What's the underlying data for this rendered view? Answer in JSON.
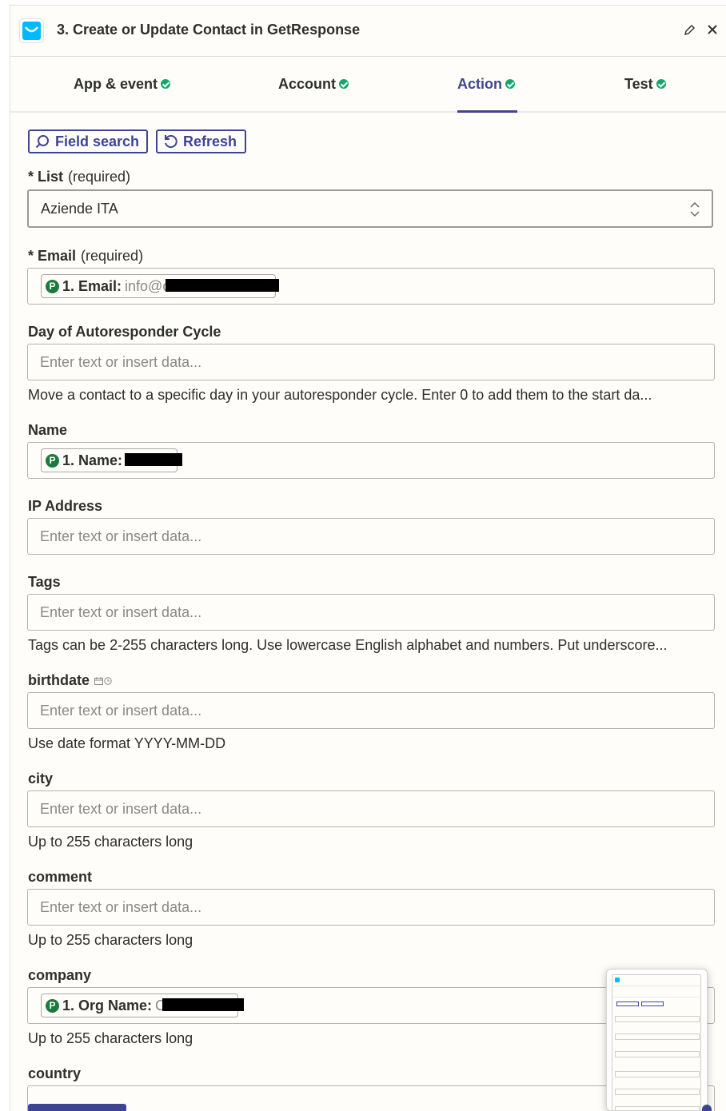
{
  "header": {
    "title": "3. Create or Update Contact in GetResponse"
  },
  "tabs": [
    {
      "label": "App & event"
    },
    {
      "label": "Account"
    },
    {
      "label": "Action"
    },
    {
      "label": "Test"
    }
  ],
  "active_tab": "Action",
  "toolbar": {
    "field_search_label": "Field search",
    "refresh_label": "Refresh"
  },
  "fields": {
    "list": {
      "label": "* List",
      "required": "(required)",
      "value": "Aziende ITA"
    },
    "email": {
      "label": "* Email",
      "required": "(required)",
      "pill_name": "1. Email:",
      "pill_value": "info@c"
    },
    "autoresponder": {
      "label": "Day of Autoresponder Cycle",
      "placeholder": "Enter text or insert data...",
      "help": "Move a contact to a specific day in your autoresponder cycle. Enter 0 to add them to the start da..."
    },
    "name": {
      "label": "Name",
      "pill_name": "1. Name:"
    },
    "ip": {
      "label": "IP Address",
      "placeholder": "Enter text or insert data..."
    },
    "tags": {
      "label": "Tags",
      "placeholder": "Enter text or insert data...",
      "help": "Tags can be 2-255 characters long. Use lowercase English alphabet and numbers. Put underscore..."
    },
    "birthdate": {
      "label": "birthdate",
      "placeholder": "Enter text or insert data...",
      "help": "Use date format YYYY-MM-DD"
    },
    "city": {
      "label": "city",
      "placeholder": "Enter text or insert data...",
      "help": "Up to 255 characters long"
    },
    "comment": {
      "label": "comment",
      "placeholder": "Enter text or insert data...",
      "help": "Up to 255 characters long"
    },
    "company": {
      "label": "company",
      "pill_name": "1. Org Name:",
      "pill_value": "C",
      "help": "Up to 255 characters long"
    },
    "country": {
      "label": "country"
    }
  },
  "pill_badge": "P",
  "colors": {
    "accent": "#3d4592",
    "success": "#13a86b",
    "app_brand": "#00baff",
    "pill_badge": "#1d7a3c"
  },
  "icons": [
    "getresponse-logo-icon",
    "pencil-icon",
    "close-icon",
    "check-circle-icon",
    "search-icon",
    "refresh-icon",
    "chevron-updown-icon",
    "calendar-icon",
    "clock-icon"
  ]
}
